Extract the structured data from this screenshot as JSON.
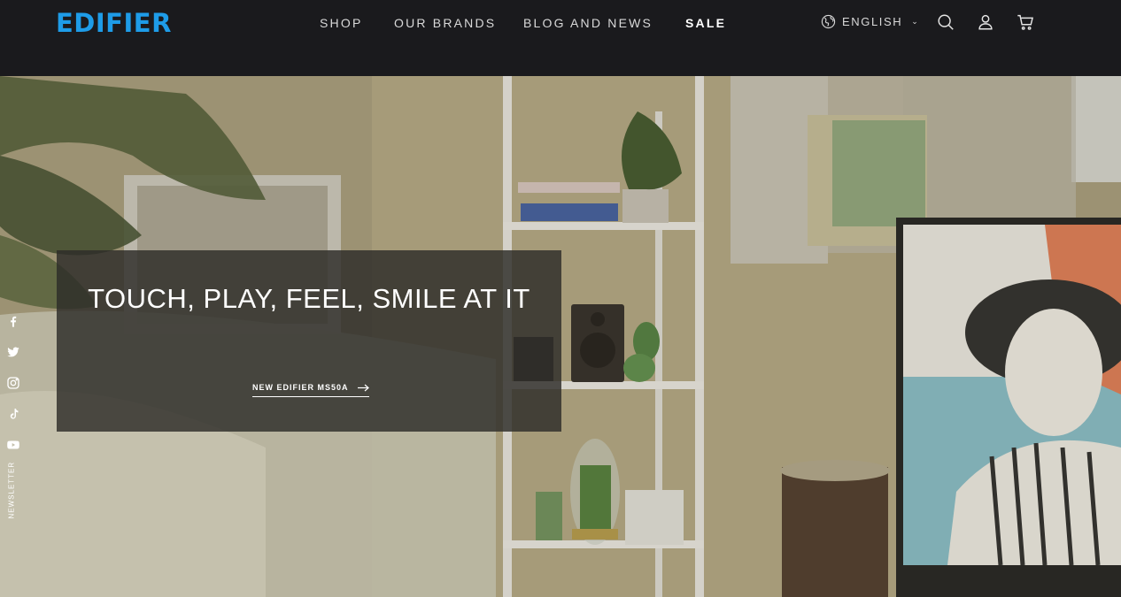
{
  "brand": {
    "logo_text": "EDIFIER",
    "accent_color": "#1e9ce8"
  },
  "nav": {
    "items": [
      {
        "label": "SHOP"
      },
      {
        "label": "OUR BRANDS"
      },
      {
        "label": "BLOG AND NEWS"
      },
      {
        "label": "SALE"
      }
    ]
  },
  "header": {
    "language": "ENGLISH",
    "icons": [
      "globe-icon",
      "search-icon",
      "account-icon",
      "cart-icon"
    ]
  },
  "hero": {
    "heading": "TOUCH, PLAY, FEEL, SMILE AT IT",
    "cta_label": "NEW EDIFIER MS50A",
    "cta_icon": "arrow-right-icon"
  },
  "social": {
    "icons": [
      "facebook-icon",
      "twitter-icon",
      "instagram-icon",
      "tiktok-icon",
      "youtube-icon"
    ],
    "newsletter_label": "NEWSLETTER"
  }
}
